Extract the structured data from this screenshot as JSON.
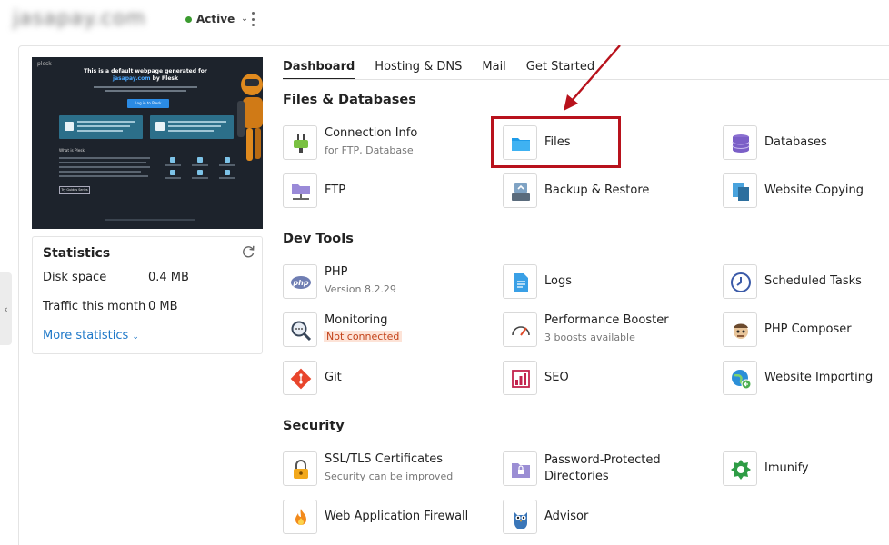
{
  "header": {
    "domain": "jasapay.com",
    "status": "Active",
    "status_color": "#3b9b2f"
  },
  "preview": {
    "logo": "plesk",
    "title_line1": "This is a default webpage generated for",
    "title_domain": "jasapay.com",
    "title_suffix": " by Plesk",
    "login_button": "Log in to Plesk",
    "what_is": "What is Plesk",
    "tour_button": "Try Guides Series"
  },
  "statistics": {
    "title": "Statistics",
    "disk_label": "Disk space",
    "disk_value": "0.4 MB",
    "traffic_label": "Traffic this month",
    "traffic_value": "0 MB",
    "more_label": "More statistics"
  },
  "tabs": [
    "Dashboard",
    "Hosting & DNS",
    "Mail",
    "Get Started"
  ],
  "sections": {
    "files": "Files & Databases",
    "dev": "Dev Tools",
    "security": "Security"
  },
  "tools": {
    "connection_info": {
      "name": "Connection Info",
      "desc": "for FTP, Database"
    },
    "files": {
      "name": "Files"
    },
    "databases": {
      "name": "Databases"
    },
    "ftp": {
      "name": "FTP"
    },
    "backup": {
      "name": "Backup & Restore"
    },
    "website_copying": {
      "name": "Website Copying"
    },
    "php": {
      "name": "PHP",
      "desc": "Version 8.2.29"
    },
    "logs": {
      "name": "Logs"
    },
    "scheduled_tasks": {
      "name": "Scheduled Tasks"
    },
    "monitoring": {
      "name": "Monitoring",
      "desc": "Not connected"
    },
    "performance_booster": {
      "name": "Performance Booster",
      "desc": "3 boosts available"
    },
    "php_composer": {
      "name": "PHP Composer"
    },
    "git": {
      "name": "Git"
    },
    "seo": {
      "name": "SEO"
    },
    "website_importing": {
      "name": "Website Importing"
    },
    "ssl": {
      "name": "SSL/TLS Certificates",
      "desc": "Security can be improved"
    },
    "password_dirs": {
      "name": "Password-Protected Directories"
    },
    "imunify": {
      "name": "Imunify"
    },
    "waf": {
      "name": "Web Application Firewall"
    },
    "advisor": {
      "name": "Advisor"
    }
  },
  "colors": {
    "accent": "#1e78c8",
    "highlight": "#b8121c",
    "warning_bg": "#fde3d7",
    "warning_text": "#c3431a"
  }
}
